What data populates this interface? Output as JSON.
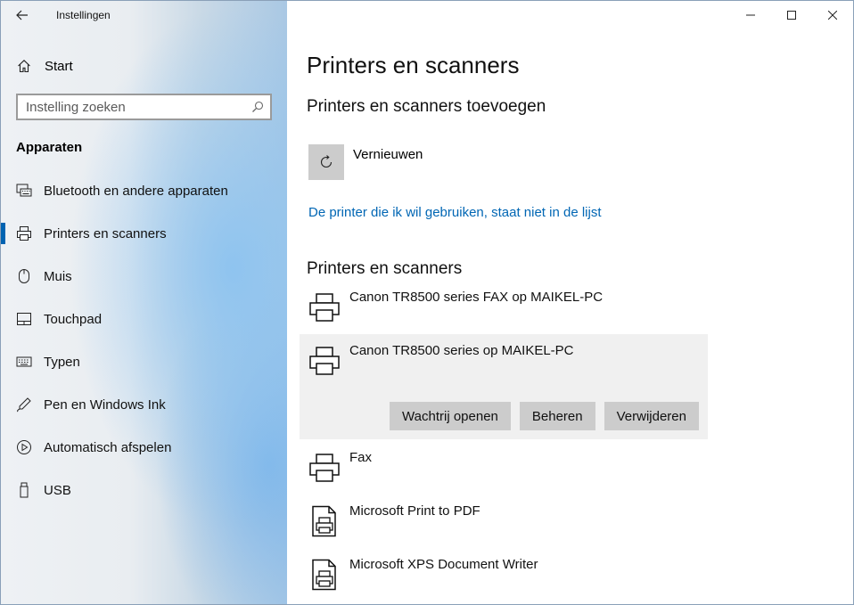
{
  "window": {
    "app_title": "Instellingen"
  },
  "sidebar": {
    "home_label": "Start",
    "search_placeholder": "Instelling zoeken",
    "section_title": "Apparaten",
    "items": [
      {
        "label": "Bluetooth en andere apparaten",
        "icon": "keyboard-display-icon"
      },
      {
        "label": "Printers en scanners",
        "icon": "printer-icon",
        "active": true
      },
      {
        "label": "Muis",
        "icon": "mouse-icon"
      },
      {
        "label": "Touchpad",
        "icon": "touchpad-icon"
      },
      {
        "label": "Typen",
        "icon": "keyboard-icon"
      },
      {
        "label": "Pen en Windows Ink",
        "icon": "pen-icon"
      },
      {
        "label": "Automatisch afspelen",
        "icon": "autoplay-icon"
      },
      {
        "label": "USB",
        "icon": "usb-icon"
      }
    ]
  },
  "main": {
    "title": "Printers en scanners",
    "add_section_title": "Printers en scanners toevoegen",
    "refresh_label": "Vernieuwen",
    "missing_printer_link": "De printer die ik wil gebruiken, staat niet in de lijst",
    "list_section_title": "Printers en scanners",
    "devices": [
      {
        "name": "Canon TR8500 series FAX op MAIKEL-PC",
        "icon": "printer-icon"
      },
      {
        "name": "Canon TR8500 series op MAIKEL-PC",
        "icon": "printer-icon",
        "selected": true
      },
      {
        "name": "Fax",
        "icon": "printer-icon"
      },
      {
        "name": "Microsoft Print to PDF",
        "icon": "document-printer-icon"
      },
      {
        "name": "Microsoft XPS Document Writer",
        "icon": "document-printer-icon"
      }
    ],
    "actions": {
      "open_queue": "Wachtrij openen",
      "manage": "Beheren",
      "remove": "Verwijderen"
    }
  },
  "colors": {
    "accent": "#0063b1",
    "link": "#0066b4",
    "tile": "#cccccc",
    "selected_bg": "#f0f0f0"
  }
}
